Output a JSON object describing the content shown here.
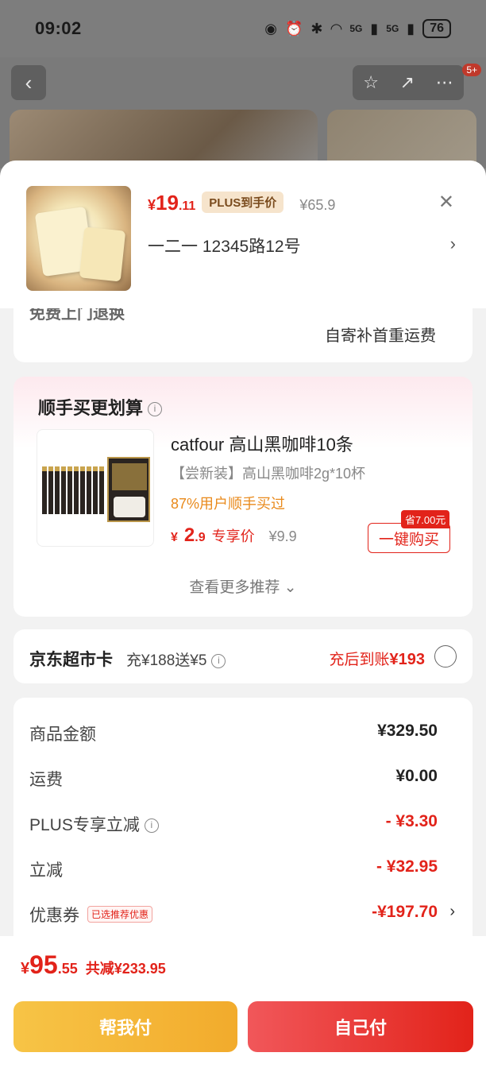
{
  "status_bar": {
    "time": "09:02",
    "signal1": "5G",
    "signal2": "5G",
    "battery": "76"
  },
  "nav": {
    "back_icon": "‹",
    "badge": "5+"
  },
  "product": {
    "price_currency": "¥",
    "price_int": "19",
    "price_dec": ".11",
    "plus_tag": "PLUS到手价",
    "orig_price": "¥65.9",
    "address": "一二一  12345路12号"
  },
  "shipping": {
    "cut_text": "免费上门退换",
    "note": "自寄补首重运费"
  },
  "recommend": {
    "title": "顺手买更划算",
    "item_name": "catfour 高山黑咖啡10条",
    "item_sub": "【尝新装】高山黑咖啡2g*10杯",
    "item_pct": "87%用户顺手买过",
    "price_currency": "¥",
    "price_int": "2",
    "price_dec": ".9",
    "exclusive": "专享价",
    "orig_price": "¥9.9",
    "save_badge": "省7.00元",
    "buy_label": "一键购买",
    "more_label": "查看更多推荐 ⌄"
  },
  "market_card": {
    "title": "京东超市卡",
    "offer": "充¥188送¥5",
    "right_text": "充后到账",
    "right_amount": "¥193"
  },
  "summary": {
    "rows": [
      {
        "label": "商品金额",
        "value": "¥329.50"
      },
      {
        "label": "运费",
        "value": "¥0.00"
      },
      {
        "label": "PLUS专享立减",
        "value": "- ¥3.30"
      },
      {
        "label": "立减",
        "value": "- ¥32.95"
      },
      {
        "label": "优惠券",
        "value": "-¥197.70",
        "tag": "已选推荐优惠"
      }
    ]
  },
  "bottom": {
    "currency": "¥",
    "total_int": "95",
    "total_dec": ".55",
    "saved": "共减¥233.95",
    "help_pay": "帮我付",
    "self_pay": "自己付"
  },
  "colors": {
    "accent_red": "#e2231a",
    "gold": "#f2ab2c",
    "plus_tag_bg": "#f6e4cc"
  }
}
